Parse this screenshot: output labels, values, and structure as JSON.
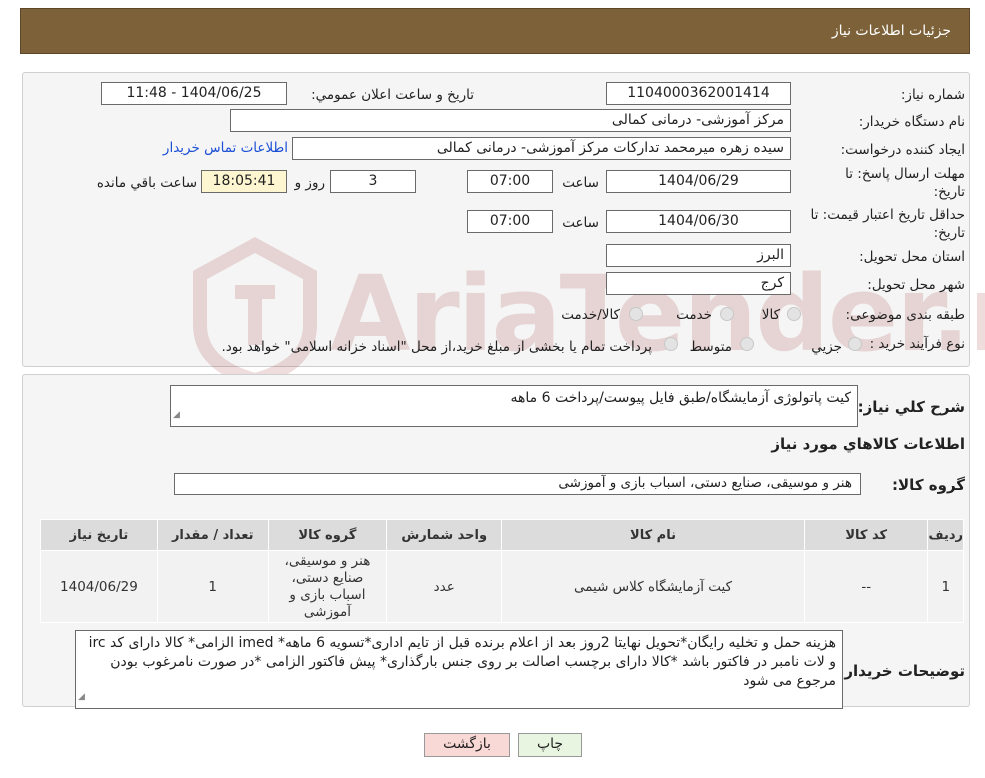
{
  "header": {
    "title": "جزئیات اطلاعات نیاز"
  },
  "form": {
    "need_number_label": "شماره نیاز:",
    "need_number": "1104000362001414",
    "announce_label": "تاریخ و ساعت اعلان عمومي:",
    "announce_value": "1404/06/25 - 11:48",
    "buyer_org_label": "نام دستگاه خريدار:",
    "buyer_org": "مرکز آموزشی- درمانی کمالی",
    "creator_label": "ايجاد کننده درخواست:",
    "creator": "سیده زهره میرمحمد تدارکات مرکز آموزشی- درمانی کمالی",
    "contact_link": "اطلاعات تماس خریدار",
    "deadline_label": "مهلت ارسال پاسخ: تا تاريخ:",
    "deadline_date": "1404/06/29",
    "time_label": "ساعت",
    "deadline_time": "07:00",
    "days_value": "3",
    "days_label": "روز و",
    "remaining_time": "18:05:41",
    "remaining_label": "ساعت باقي مانده",
    "validity_label": "حداقل تاريخ اعتبار قيمت: تا تاريخ:",
    "validity_date": "1404/06/30",
    "validity_time": "07:00",
    "province_label": "استان محل تحويل:",
    "province": "البرز",
    "city_label": "شهر محل تحويل:",
    "city": "کرج",
    "category_label": "طبقه بندی موضوعی:",
    "category_options": [
      "کالا",
      "خدمت",
      "کالا/خدمت"
    ],
    "process_label": "نوع فرآيند خريد :",
    "process_options": [
      "جزيي",
      "متوسط"
    ],
    "process_note": "پرداخت تمام يا بخشی از مبلغ خريد،از محل \"اسناد خزانه اسلامی\" خواهد بود."
  },
  "details": {
    "description_label": "شرح کلي نياز:",
    "description": "کیت پاتولوژی آزمایشگاه/طبق فایل پیوست/پرداخت 6 ماهه",
    "goods_info_title": "اطلاعات کالاهاي مورد نياز",
    "goods_group_label": "گروه کالا:",
    "goods_group": "هنر و موسیقی، صنایع دستی، اسباب بازی و آموزشی"
  },
  "table": {
    "headers": [
      "رديف",
      "کد کالا",
      "نام کالا",
      "واحد شمارش",
      "گروه کالا",
      "تعداد / مقدار",
      "تاريخ نياز"
    ],
    "rows": [
      [
        "1",
        "--",
        "کیت آزمایشگاه کلاس شیمی",
        "عدد",
        "هنر و موسیقی، صنایع دستی، اسباب بازی و آموزشی",
        "1",
        "1404/06/29"
      ]
    ]
  },
  "notes": {
    "label": "توضيحات خريدار:",
    "text": "هزینه حمل و تخلیه رایگان*تحویل نهایتا 2روز بعد از اعلام برنده قبل از تایم اداری*تسویه 6 ماهه* imed الزامی* کالا دارای کد irc و لات نامبر در فاکتور باشد *کالا دارای برچسب اصالت بر روی جنس بارگذاری* پیش فاکتور الزامی *در صورت نامرغوب بودن مرجوع می شود"
  },
  "buttons": {
    "print": "چاپ",
    "back": "بازگشت"
  },
  "watermark": {
    "text": "AriaTender.neT"
  },
  "colors": {
    "header_bg": "#7d6139",
    "link": "#1a4fd6",
    "back_button_bg": "#f9d9d6",
    "print_button_bg": "#e8f5e0"
  }
}
